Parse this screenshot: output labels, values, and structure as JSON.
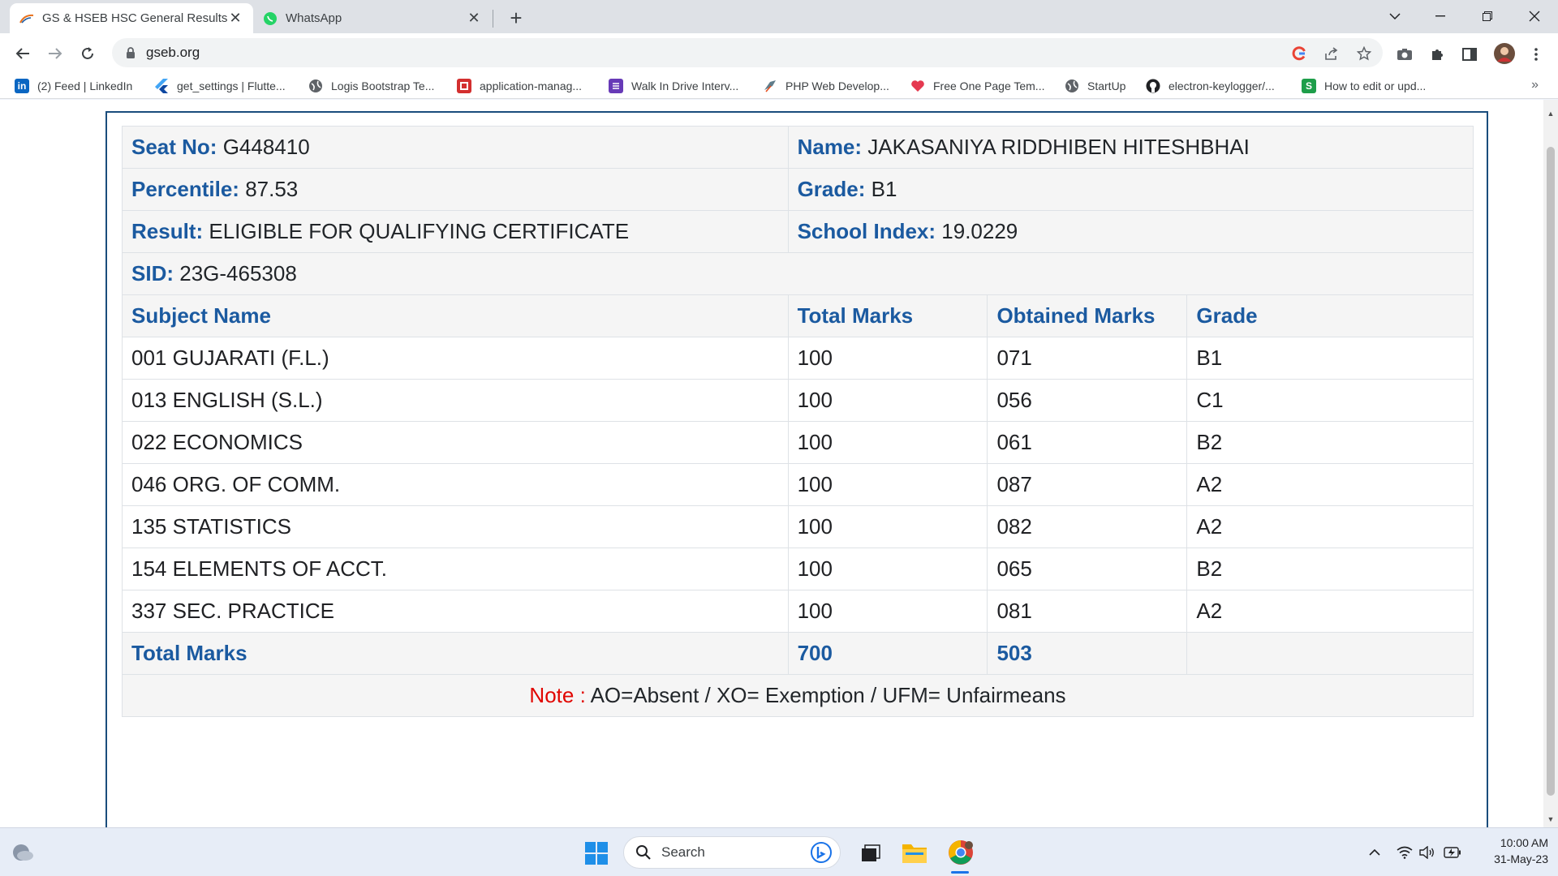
{
  "browser": {
    "tabs": [
      {
        "title": "GS & HSEB HSC General Results |",
        "active": true,
        "icon": "gseb-logo-icon"
      },
      {
        "title": "WhatsApp",
        "active": false,
        "icon": "whatsapp-icon"
      }
    ],
    "url": "gseb.org",
    "bookmarks": [
      {
        "label": "(2) Feed | LinkedIn",
        "icon": "linkedin-icon"
      },
      {
        "label": "get_settings | Flutte...",
        "icon": "flutter-icon"
      },
      {
        "label": "Logis Bootstrap Te...",
        "icon": "globe-icon"
      },
      {
        "label": "application-manag...",
        "icon": "red-square-icon"
      },
      {
        "label": "Walk In Drive Interv...",
        "icon": "purple-form-icon"
      },
      {
        "label": "PHP Web Develop...",
        "icon": "bird-icon"
      },
      {
        "label": "Free One Page Tem...",
        "icon": "heart-icon"
      },
      {
        "label": "StartUp",
        "icon": "globe-icon"
      },
      {
        "label": "electron-keylogger/...",
        "icon": "github-icon"
      },
      {
        "label": "How to edit or upd...",
        "icon": "green-s-icon"
      }
    ],
    "more_bookmarks": "»"
  },
  "result": {
    "seat": {
      "label": "Seat No:",
      "value": "G448410"
    },
    "name": {
      "label": "Name:",
      "value": "JAKASANIYA RIDDHIBEN HITESHBHAI"
    },
    "percentile": {
      "label": "Percentile:",
      "value": "87.53"
    },
    "grade": {
      "label": "Grade:",
      "value": "B1"
    },
    "result": {
      "label": "Result:",
      "value": "ELIGIBLE FOR QUALIFYING CERTIFICATE"
    },
    "school_index": {
      "label": "School Index:",
      "value": "19.0229"
    },
    "sid": {
      "label": "SID:",
      "value": "23G-465308"
    },
    "headers": {
      "subject": "Subject Name",
      "total": "Total Marks",
      "obtained": "Obtained Marks",
      "grade": "Grade"
    },
    "subjects": [
      {
        "name": "001 GUJARATI (F.L.)",
        "total": "100",
        "obtained": "071",
        "grade": "B1"
      },
      {
        "name": "013 ENGLISH (S.L.)",
        "total": "100",
        "obtained": "056",
        "grade": "C1"
      },
      {
        "name": "022 ECONOMICS",
        "total": "100",
        "obtained": "061",
        "grade": "B2"
      },
      {
        "name": "046 ORG. OF COMM.",
        "total": "100",
        "obtained": "087",
        "grade": "A2"
      },
      {
        "name": "135 STATISTICS",
        "total": "100",
        "obtained": "082",
        "grade": "A2"
      },
      {
        "name": "154 ELEMENTS OF ACCT.",
        "total": "100",
        "obtained": "065",
        "grade": "B2"
      },
      {
        "name": "337 SEC. PRACTICE",
        "total": "100",
        "obtained": "081",
        "grade": "A2"
      }
    ],
    "totals": {
      "label": "Total Marks",
      "total": "700",
      "obtained": "503"
    },
    "note": {
      "label": "Note :",
      "text": "AO=Absent / XO= Exemption / UFM= Unfairmeans"
    }
  },
  "taskbar": {
    "search_placeholder": "Search",
    "time": "10:00 AM",
    "date": "31-May-23"
  },
  "colors": {
    "label_blue": "#1b5aa0",
    "note_red": "#e10600",
    "frame_border": "#1a4d7c"
  }
}
